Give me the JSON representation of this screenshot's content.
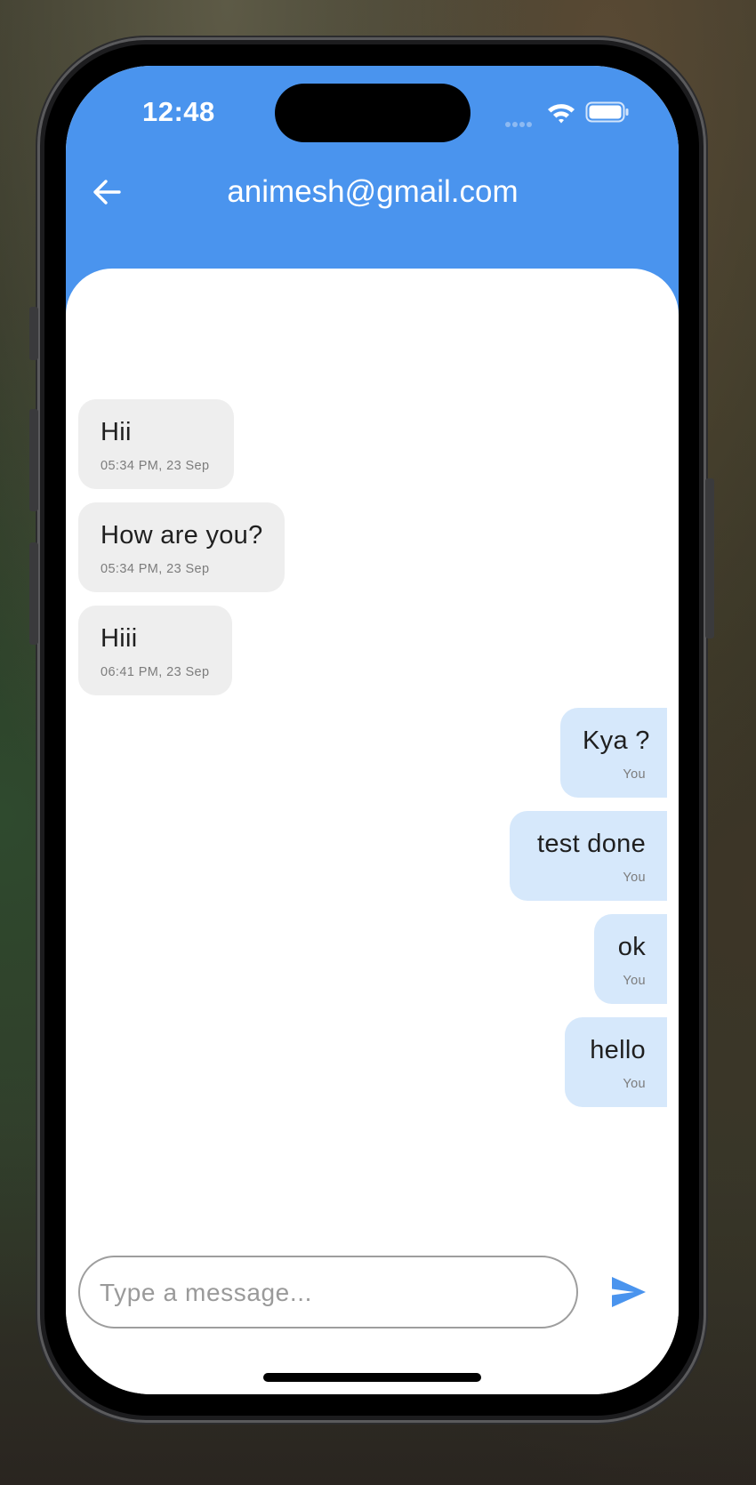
{
  "status_bar": {
    "time": "12:48",
    "icons": [
      "signal-icon",
      "wifi-icon",
      "battery-icon"
    ]
  },
  "header": {
    "title": "animesh@gmail.com",
    "back_icon": "arrow-left-icon",
    "color": "#4a94ee"
  },
  "messages": [
    {
      "text": "Hii",
      "meta": "05:34 PM, 23 Sep",
      "sender": "other"
    },
    {
      "text": "How are you?",
      "meta": "05:34 PM, 23 Sep",
      "sender": "other"
    },
    {
      "text": "Hiii",
      "meta": "06:41 PM, 23 Sep",
      "sender": "other"
    },
    {
      "text": "Kya ?",
      "meta": "You",
      "sender": "me"
    },
    {
      "text": "test done",
      "meta": "You",
      "sender": "me"
    },
    {
      "text": "ok",
      "meta": "You",
      "sender": "me"
    },
    {
      "text": "hello",
      "meta": "You",
      "sender": "me"
    }
  ],
  "composer": {
    "placeholder": "Type a message...",
    "value": "",
    "send_icon": "send-icon"
  },
  "colors": {
    "received_bubble": "#eeeeee",
    "sent_bubble": "#d6e8fb",
    "accent": "#4a94ee"
  }
}
